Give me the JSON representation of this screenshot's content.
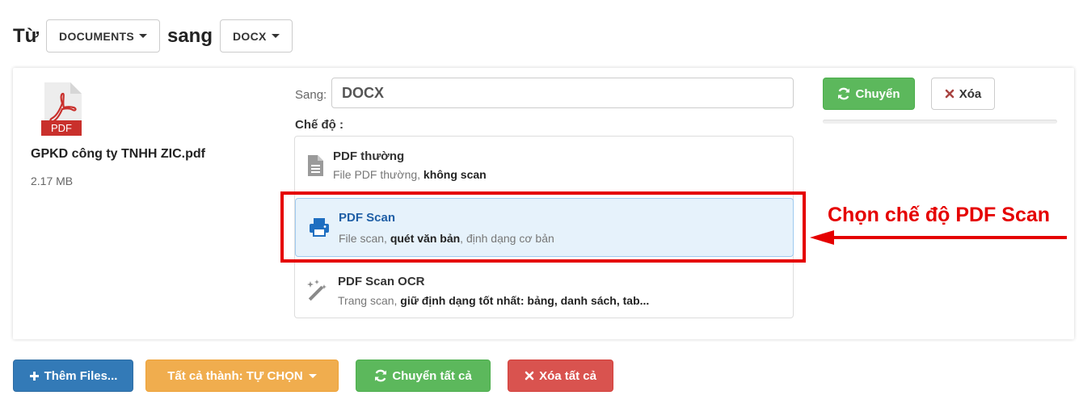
{
  "top": {
    "from_label": "Từ",
    "from_value": "DOCUMENTS",
    "to_label": "sang",
    "to_value": "DOCX"
  },
  "file": {
    "icon_text": "PDF",
    "name": "GPKD công ty TNHH ZIC.pdf",
    "size": "2.17 MB"
  },
  "target": {
    "label": "Sang:",
    "value": "DOCX"
  },
  "mode": {
    "label": "Chế độ :",
    "options": [
      {
        "title": "PDF thường",
        "desc_plain": "File PDF thường, ",
        "desc_bold": "không scan",
        "desc_tail": "",
        "icon": "document-icon"
      },
      {
        "title": "PDF Scan",
        "desc_plain": "File scan, ",
        "desc_bold": "quét văn bản",
        "desc_tail": ", định dạng cơ bản",
        "icon": "printer-icon",
        "selected": true
      },
      {
        "title": "PDF Scan OCR",
        "desc_plain": "Trang scan, ",
        "desc_bold": "giữ định dạng tốt nhất: bảng, danh sách, tab...",
        "desc_tail": "",
        "icon": "magic-wand-icon"
      }
    ]
  },
  "actions": {
    "convert": "Chuyển",
    "delete": "Xóa"
  },
  "bottom": {
    "add_files": "Thêm Files...",
    "all_to": "Tất cả thành: TỰ CHỌN",
    "convert_all": "Chuyển tất cả",
    "delete_all": "Xóa tất cả"
  },
  "annotation": {
    "text": "Chọn chế độ PDF Scan"
  },
  "colors": {
    "accent_red": "#e50000",
    "green": "#5cb85c",
    "blue": "#337ab7",
    "orange": "#f0ad4e",
    "danger": "#d9534f",
    "selected_bg": "#e6f2fb",
    "selected_title": "#1f5fa6",
    "pdf_red": "#c9302c"
  }
}
